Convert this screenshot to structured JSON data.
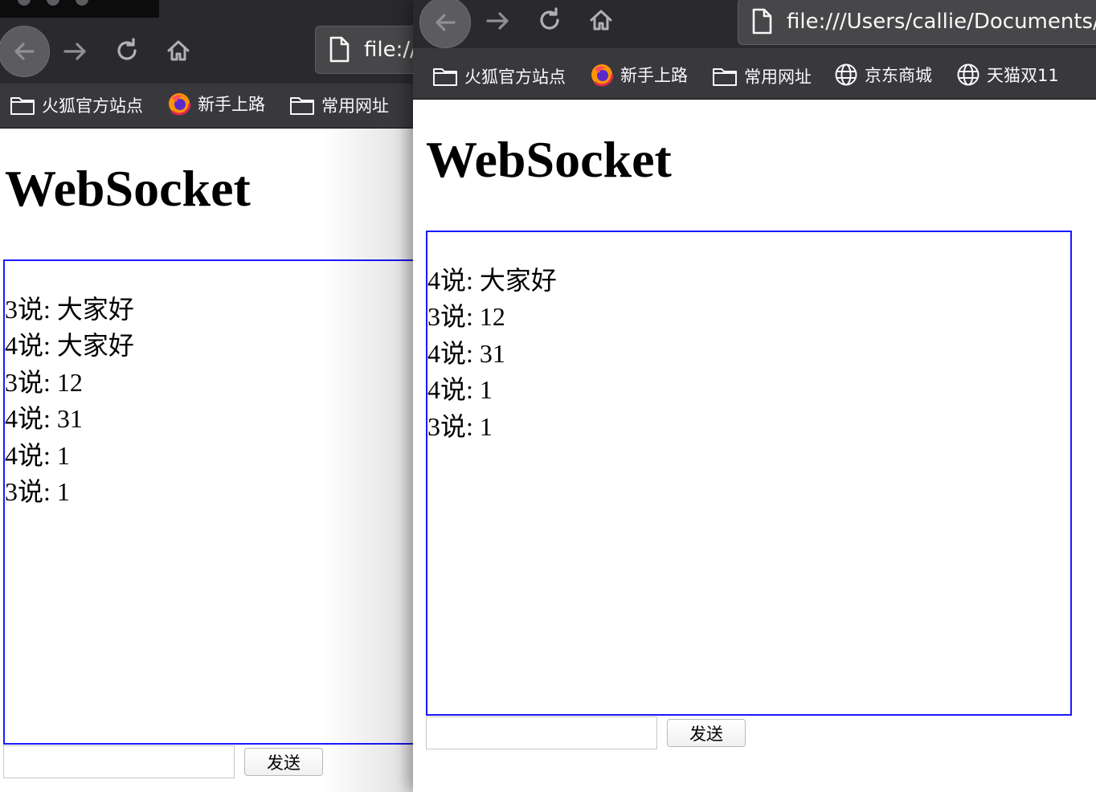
{
  "left_window": {
    "url": "file://",
    "bookmarks": [
      {
        "label": "火狐官方站点",
        "icon": "folder-icon"
      },
      {
        "label": "新手上路",
        "icon": "firefox-icon"
      },
      {
        "label": "常用网址",
        "icon": "folder-icon"
      }
    ],
    "title": "WebSocket",
    "messages": [
      "3说: 大家好",
      "4说: 大家好",
      "3说: 12",
      "4说: 31",
      "4说: 1",
      "3说: 1"
    ],
    "input_value": "",
    "send_label": "发送"
  },
  "right_window": {
    "url": "file:///Users/callie/Documents/",
    "bookmarks": [
      {
        "label": "火狐官方站点",
        "icon": "folder-icon"
      },
      {
        "label": "新手上路",
        "icon": "firefox-icon"
      },
      {
        "label": "常用网址",
        "icon": "folder-icon"
      },
      {
        "label": "京东商城",
        "icon": "globe-icon"
      },
      {
        "label": "天猫双11",
        "icon": "globe-icon"
      }
    ],
    "title": "WebSocket",
    "messages": [
      "4说: 大家好",
      "3说: 12",
      "4说: 31",
      "4说: 1",
      "3说: 1"
    ],
    "input_value": "",
    "send_label": "发送"
  },
  "colors": {
    "toolbar": "#2a2a2e",
    "bookmarks_bar": "#38383d",
    "message_box_border": "#1a1aff"
  }
}
